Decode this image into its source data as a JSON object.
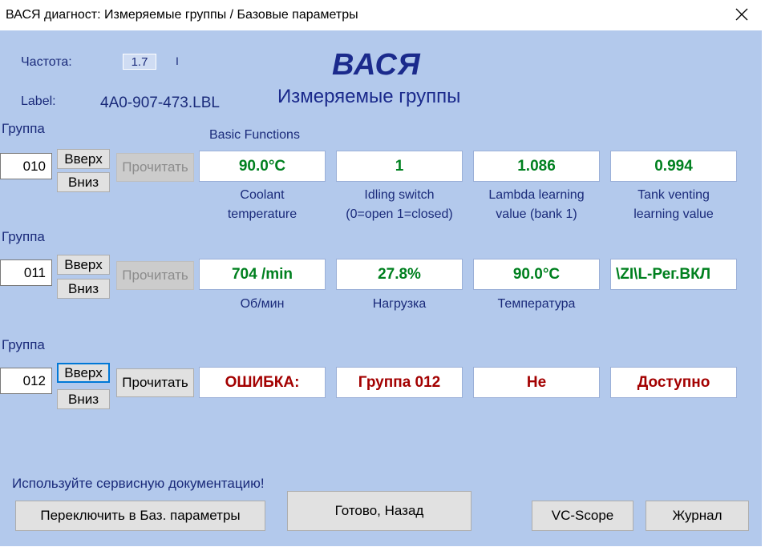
{
  "window": {
    "title": "ВАСЯ диагност: Измеряемые группы / Базовые параметры"
  },
  "header": {
    "freq_label": "Частота:",
    "freq_value": "1.7",
    "freq_marker": "I",
    "label_caption": "Label:",
    "label_value": "4A0-907-473.LBL",
    "logo": "ВАСЯ",
    "subtitle": "Измеряемые группы",
    "mode": "Basic Functions"
  },
  "groups": [
    {
      "label": "Группа",
      "number": "010",
      "up": "Вверх",
      "down": "Вниз",
      "read": "Прочитать",
      "values": [
        "90.0°C",
        "1",
        "1.086",
        "0.994"
      ],
      "captions": [
        "Coolant\ntemperature",
        "Idling switch\n(0=open 1=closed)",
        "Lambda learning\nvalue (bank 1)",
        "Tank venting\nlearning value"
      ]
    },
    {
      "label": "Группа",
      "number": "011",
      "up": "Вверх",
      "down": "Вниз",
      "read": "Прочитать",
      "values": [
        "704 /min",
        "27.8%",
        "90.0°C",
        "\\ZI\\L-Рег.ВКЛ"
      ],
      "captions": [
        "Об/мин",
        "Нагрузка",
        "Температура",
        ""
      ]
    },
    {
      "label": "Группа",
      "number": "012",
      "up": "Вверх",
      "down": "Вниз",
      "read": "Прочитать",
      "values": [
        "ОШИБКА:",
        "Группа 012",
        "Не",
        "Доступно"
      ],
      "captions": [
        "",
        "",
        "",
        ""
      ]
    }
  ],
  "footer": {
    "notice": "Используйте сервисную документацию!",
    "switch_button": "Переключить в Баз. параметры",
    "done_button": "Готово, Назад",
    "vcscope_button": "VC-Scope",
    "log_button": "Журнал"
  },
  "colors": {
    "background": "#b3c9ec",
    "value_ok": "#00801f",
    "value_error": "#a30000",
    "accent": "#1b2a8c"
  }
}
